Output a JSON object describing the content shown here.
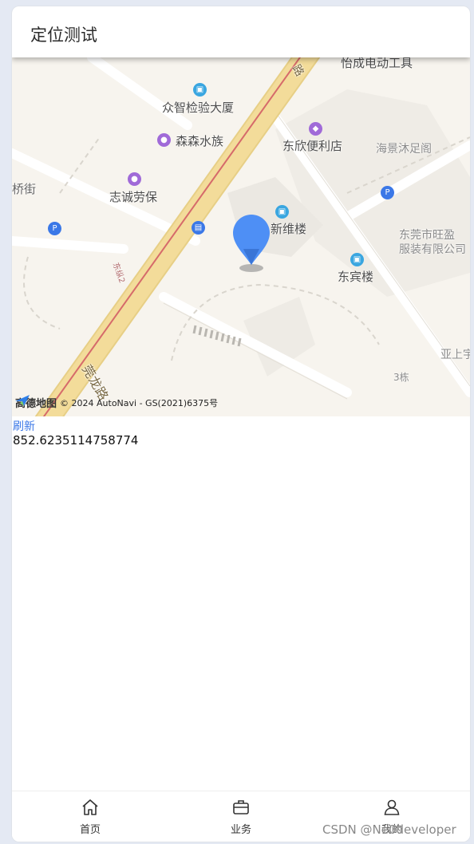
{
  "header": {
    "title": "定位测试"
  },
  "map": {
    "pois": {
      "top_cut": "怡成电动工具",
      "zhongzhi": "众智检验大厦",
      "sensen": "森森水族",
      "dongxin": "东欣便利店",
      "haijing": "海景沐足阁",
      "qiaojie": "桥街",
      "zhicheng": "志诚劳保",
      "xinweilou": "新维楼",
      "wangying_line1": "东莞市旺盈",
      "wangying_line2": "服装有限公司",
      "dongbinlou": "东宾楼",
      "building3": "3栋",
      "yashang": "亚上宇",
      "road_guanlong": "莞龙路",
      "road_top": "路",
      "road_small": "东纵2"
    },
    "attribution": {
      "logo": "高德地图",
      "text": "© 2024 AutoNavi - GS(2021)6375号"
    }
  },
  "refresh_label": "刷新",
  "value_text": "852.6235114758774",
  "tabbar": {
    "home": "首页",
    "business": "业务",
    "mine": "我的"
  },
  "watermark": "CSDN @Ne0developer",
  "colors": {
    "accent": "#3b78e7",
    "pin": "#4e8ff5",
    "road_yellow": "#f3dc9a",
    "road_red": "#d66a6a"
  }
}
